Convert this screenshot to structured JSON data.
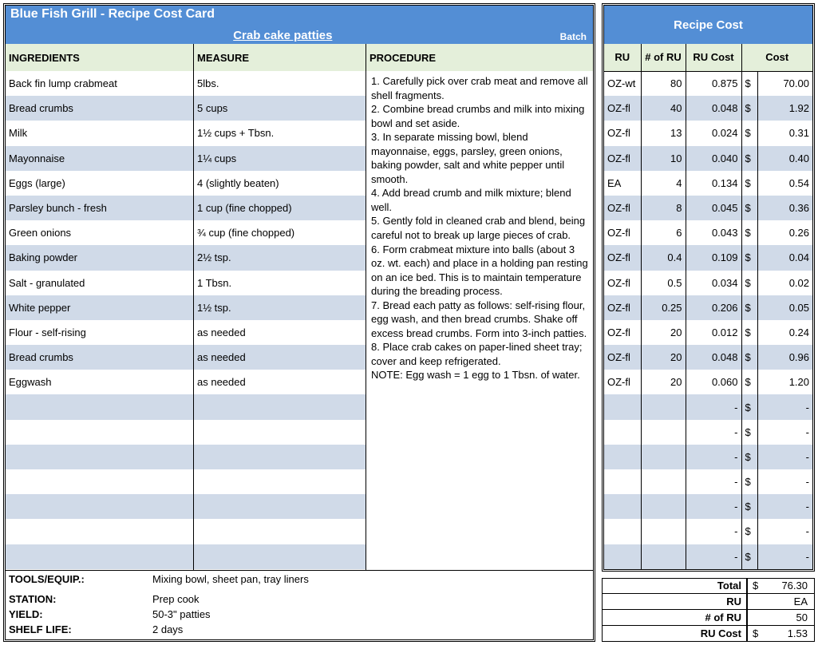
{
  "header": {
    "title": "Blue Fish Grill - Recipe Cost Card",
    "recipe": "Crab cake patties",
    "batch": "Batch",
    "recipe_cost": "Recipe Cost"
  },
  "col_heads": {
    "ingredients": "INGREDIENTS",
    "measure": "MEASURE",
    "procedure": "PROCEDURE",
    "ru": "RU",
    "nru": "# of RU",
    "rucost": "RU Cost",
    "cost": "Cost"
  },
  "rows": [
    {
      "ingredient": "Back fin lump crabmeat",
      "measure": "5lbs.",
      "ru": "OZ-wt",
      "nru": "80",
      "rucost": "0.875",
      "sym": "$",
      "cost": "70.00"
    },
    {
      "ingredient": "Bread crumbs",
      "measure": "5 cups",
      "ru": "OZ-fl",
      "nru": "40",
      "rucost": "0.048",
      "sym": "$",
      "cost": "1.92"
    },
    {
      "ingredient": "Milk",
      "measure": "1½ cups + Tbsn.",
      "ru": "OZ-fl",
      "nru": "13",
      "rucost": "0.024",
      "sym": "$",
      "cost": "0.31"
    },
    {
      "ingredient": "Mayonnaise",
      "measure": "1¼ cups",
      "ru": "OZ-fl",
      "nru": "10",
      "rucost": "0.040",
      "sym": "$",
      "cost": "0.40"
    },
    {
      "ingredient": "Eggs (large)",
      "measure": "4 (slightly beaten)",
      "ru": "EA",
      "nru": "4",
      "rucost": "0.134",
      "sym": "$",
      "cost": "0.54"
    },
    {
      "ingredient": "Parsley bunch - fresh",
      "measure": "1 cup (fine chopped)",
      "ru": "OZ-fl",
      "nru": "8",
      "rucost": "0.045",
      "sym": "$",
      "cost": "0.36"
    },
    {
      "ingredient": "Green onions",
      "measure": "¾ cup (fine chopped)",
      "ru": "OZ-fl",
      "nru": "6",
      "rucost": "0.043",
      "sym": "$",
      "cost": "0.26"
    },
    {
      "ingredient": "Baking powder",
      "measure": "2½ tsp.",
      "ru": "OZ-fl",
      "nru": "0.4",
      "rucost": "0.109",
      "sym": "$",
      "cost": "0.04"
    },
    {
      "ingredient": "Salt - granulated",
      "measure": "1 Tbsn.",
      "ru": "OZ-fl",
      "nru": "0.5",
      "rucost": "0.034",
      "sym": "$",
      "cost": "0.02"
    },
    {
      "ingredient": "White pepper",
      "measure": "1½ tsp.",
      "ru": "OZ-fl",
      "nru": "0.25",
      "rucost": "0.206",
      "sym": "$",
      "cost": "0.05"
    },
    {
      "ingredient": "Flour - self-rising",
      "measure": "as needed",
      "ru": "OZ-fl",
      "nru": "20",
      "rucost": "0.012",
      "sym": "$",
      "cost": "0.24"
    },
    {
      "ingredient": "Bread crumbs",
      "measure": "as needed",
      "ru": "OZ-fl",
      "nru": "20",
      "rucost": "0.048",
      "sym": "$",
      "cost": "0.96"
    },
    {
      "ingredient": "Eggwash",
      "measure": "as needed",
      "ru": "OZ-fl",
      "nru": "20",
      "rucost": "0.060",
      "sym": "$",
      "cost": "1.20"
    },
    {
      "ingredient": "",
      "measure": "",
      "ru": "",
      "nru": "",
      "rucost": "-",
      "sym": "$",
      "cost": "-"
    },
    {
      "ingredient": "",
      "measure": "",
      "ru": "",
      "nru": "",
      "rucost": "-",
      "sym": "$",
      "cost": "-"
    },
    {
      "ingredient": "",
      "measure": "",
      "ru": "",
      "nru": "",
      "rucost": "-",
      "sym": "$",
      "cost": "-"
    },
    {
      "ingredient": "",
      "measure": "",
      "ru": "",
      "nru": "",
      "rucost": "-",
      "sym": "$",
      "cost": "-"
    },
    {
      "ingredient": "",
      "measure": "",
      "ru": "",
      "nru": "",
      "rucost": "-",
      "sym": "$",
      "cost": "-"
    },
    {
      "ingredient": "",
      "measure": "",
      "ru": "",
      "nru": "",
      "rucost": "-",
      "sym": "$",
      "cost": "-"
    },
    {
      "ingredient": "",
      "measure": "",
      "ru": "",
      "nru": "",
      "rucost": "-",
      "sym": "$",
      "cost": "-"
    }
  ],
  "procedure": "1. Carefully pick over crab meat and remove all shell fragments.\n2. Combine bread crumbs and milk into mixing bowl and set aside.\n3. In separate missing bowl, blend mayonnaise, eggs, parsley, green onions, baking powder, salt and white pepper until smooth.\n4. Add bread crumb and milk mixture; blend well.\n5. Gently fold in cleaned crab and blend, being careful not to break up large pieces of crab.\n6. Form crabmeat mixture into balls (about 3 oz. wt. each) and place in a holding pan resting on an ice bed. This is to maintain temperature during the breading process.\n7. Bread each patty as follows: self-rising flour, egg wash, and then bread crumbs. Shake off excess bread crumbs. Form into 3-inch patties.\n8. Place crab cakes on paper-lined sheet tray; cover and keep refrigerated.\nNOTE: Egg wash = 1 egg to 1 Tbsn. of water.",
  "tools": {
    "label_tools": "TOOLS/EQUIP.:",
    "tools": "Mixing bowl, sheet pan, tray liners",
    "label_station": "STATION:",
    "station": "Prep cook",
    "label_yield": "YIELD:",
    "yield": "50-3\" patties",
    "label_shelf": "SHELF LIFE:",
    "shelf": "2 days"
  },
  "summary": {
    "total_label": "Total",
    "total_sym": "$",
    "total_val": "76.30",
    "ru_label": "RU",
    "ru_val": "EA",
    "nru_label": "# of RU",
    "nru_val": "50",
    "rucost_label": "RU Cost",
    "rucost_sym": "$",
    "rucost_val": "1.53"
  }
}
